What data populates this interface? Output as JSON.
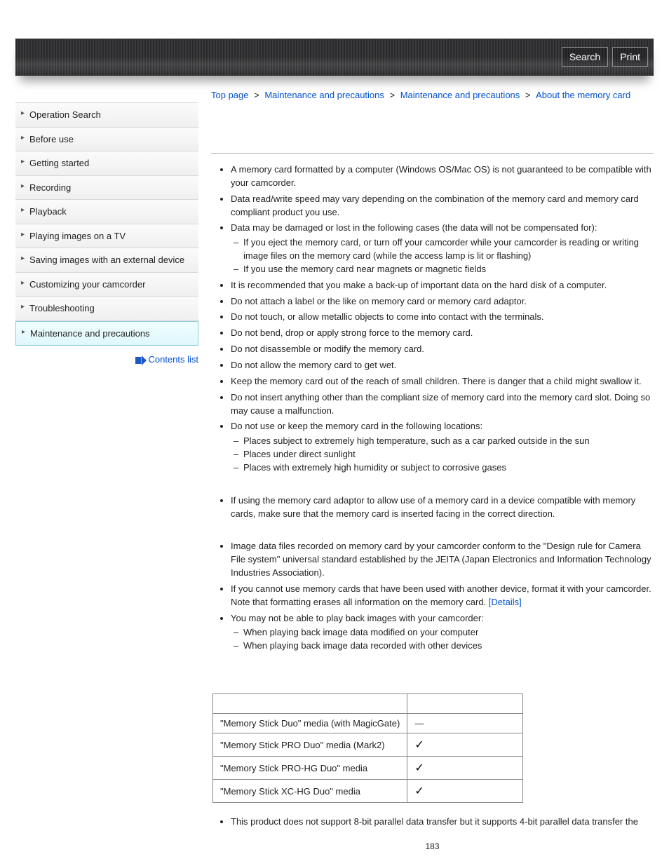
{
  "header": {
    "search_label": "Search",
    "print_label": "Print"
  },
  "sidebar": {
    "items": [
      "Operation Search",
      "Before use",
      "Getting started",
      "Recording",
      "Playback",
      "Playing images on a TV",
      "Saving images with an external device",
      "Customizing your camcorder",
      "Troubleshooting",
      "Maintenance and precautions"
    ],
    "active_index": 9,
    "contents_list_label": "Contents list"
  },
  "breadcrumbs": {
    "items": [
      "Top page",
      "Maintenance and precautions",
      "Maintenance and precautions",
      "About the memory card"
    ],
    "sep": ">"
  },
  "content": {
    "pre_link_text": "If you cannot use memory cards that have been used with another device, format it with your camcorder. Note that formatting erases all information on the memory card. ",
    "details_link": "[Details]",
    "list1": [
      {
        "text": "A memory card formatted by a computer (Windows OS/Mac OS) is not guaranteed to be compatible with your camcorder."
      },
      {
        "text": "Data read/write speed may vary depending on the combination of the memory card and memory card compliant product you use."
      },
      {
        "text": "Data may be damaged or lost in the following cases (the data will not be compensated for):",
        "sub": [
          "If you eject the memory card, or turn off your camcorder while your camcorder is reading or writing image files on the memory card (while the access lamp is lit or flashing)",
          "If you use the memory card near magnets or magnetic fields"
        ]
      },
      {
        "text": "It is recommended that you make a back-up of important data on the hard disk of a computer."
      },
      {
        "text": "Do not attach a label or the like on memory card or memory card adaptor."
      },
      {
        "text": "Do not touch, or allow metallic objects to come into contact with the terminals."
      },
      {
        "text": "Do not bend, drop or apply strong force to the memory card."
      },
      {
        "text": "Do not disassemble or modify the memory card."
      },
      {
        "text": "Do not allow the memory card to get wet."
      },
      {
        "text": "Keep the memory card out of the reach of small children. There is danger that a child might swallow it."
      },
      {
        "text": "Do not insert anything other than the compliant size of memory card into the memory card slot. Doing so may cause a malfunction."
      },
      {
        "text": "Do not use or keep the memory card in the following locations:",
        "sub": [
          "Places subject to extremely high temperature, such as a car parked outside in the sun",
          "Places under direct sunlight",
          "Places with extremely high humidity or subject to corrosive gases"
        ]
      }
    ],
    "list2": [
      {
        "text": "If using the memory card adaptor to allow use of a memory card in a device compatible with memory cards, make sure that the memory card is inserted facing in the correct direction."
      }
    ],
    "list3": [
      {
        "text": "Image data files recorded on memory card by your camcorder conform to the \"Design rule for Camera File system\" universal standard established by the JEITA (Japan Electronics and Information Technology Industries Association)."
      },
      {
        "link_item": true
      },
      {
        "text": "You may not be able to play back images with your camcorder:",
        "sub": [
          "When playing back image data modified on your computer",
          "When playing back image data recorded with other devices"
        ]
      }
    ],
    "table": {
      "header_col1": "",
      "header_col2": "",
      "rows": [
        {
          "name": "\"Memory Stick Duo\" media (with MagicGate)",
          "value": "—"
        },
        {
          "name": "\"Memory Stick PRO Duo\" media (Mark2)",
          "value": "✓"
        },
        {
          "name": "\"Memory Stick PRO-HG Duo\" media",
          "value": "✓"
        },
        {
          "name": "\"Memory Stick XC-HG Duo\" media",
          "value": "✓"
        }
      ]
    },
    "list4": [
      {
        "text": "This product does not support 8-bit parallel data transfer but it supports 4-bit parallel data transfer the"
      }
    ],
    "page_number": "183"
  }
}
